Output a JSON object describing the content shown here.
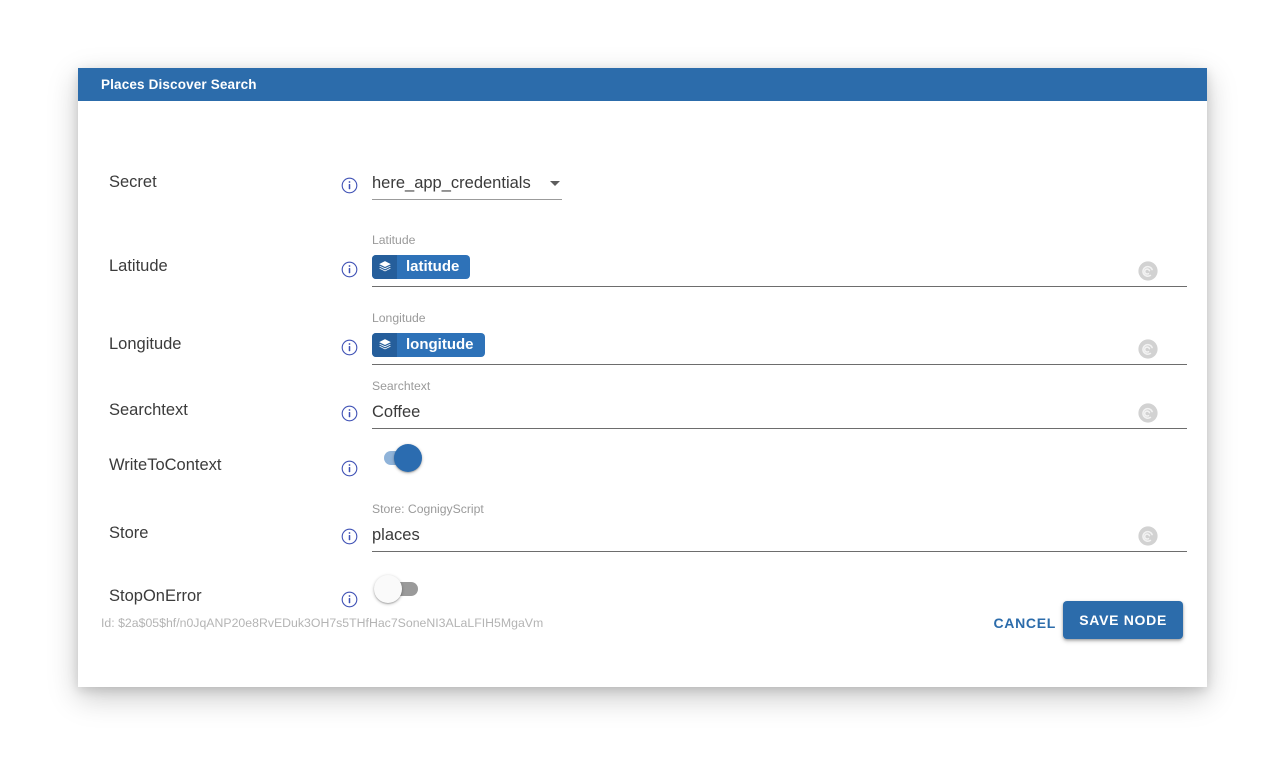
{
  "dialog": {
    "title": "Places Discover Search"
  },
  "rows": [
    {
      "label": "Secret",
      "type": "select",
      "info_icon": "info-icon",
      "value": "here_app_credentials",
      "arrow_icon": "chevron-down-icon"
    },
    {
      "label": "Latitude",
      "type": "chip",
      "info_icon": "info-icon",
      "caption": "Latitude",
      "chip_text": "latitude",
      "chip_icon": "layers-icon",
      "end_icon": "cognigy-spiral-icon"
    },
    {
      "label": "Longitude",
      "type": "chip",
      "info_icon": "info-icon",
      "caption": "Longitude",
      "chip_text": "longitude",
      "chip_icon": "layers-icon",
      "end_icon": "cognigy-spiral-icon"
    },
    {
      "label": "Searchtext",
      "type": "text",
      "info_icon": "info-icon",
      "caption": "Searchtext",
      "value": "Coffee",
      "end_icon": "cognigy-spiral-icon"
    },
    {
      "label": "WriteToContext",
      "type": "toggle",
      "info_icon": "info-icon",
      "state": "on"
    },
    {
      "label": "Store",
      "type": "text",
      "info_icon": "info-icon",
      "caption": "Store: CognigyScript",
      "value": "places",
      "end_icon": "cognigy-spiral-icon"
    },
    {
      "label": "StopOnError",
      "type": "toggle",
      "info_icon": "info-icon",
      "state": "off"
    }
  ],
  "footer": {
    "id_text": "Id: $2a$05$hf/n0JqANP20e8RvEDuk3OH7s5THfHac7SoneNI3ALaLFIH5MgaVm",
    "cancel_label": "CANCEL",
    "save_label": "SAVE NODE"
  },
  "colors": {
    "header_blue": "#2c6cab",
    "chip_blue": "#2e72b8",
    "chip_icon_blue": "#255e9b",
    "toggle_on": "#2b6cb0",
    "info_blue": "#3f51b5"
  }
}
